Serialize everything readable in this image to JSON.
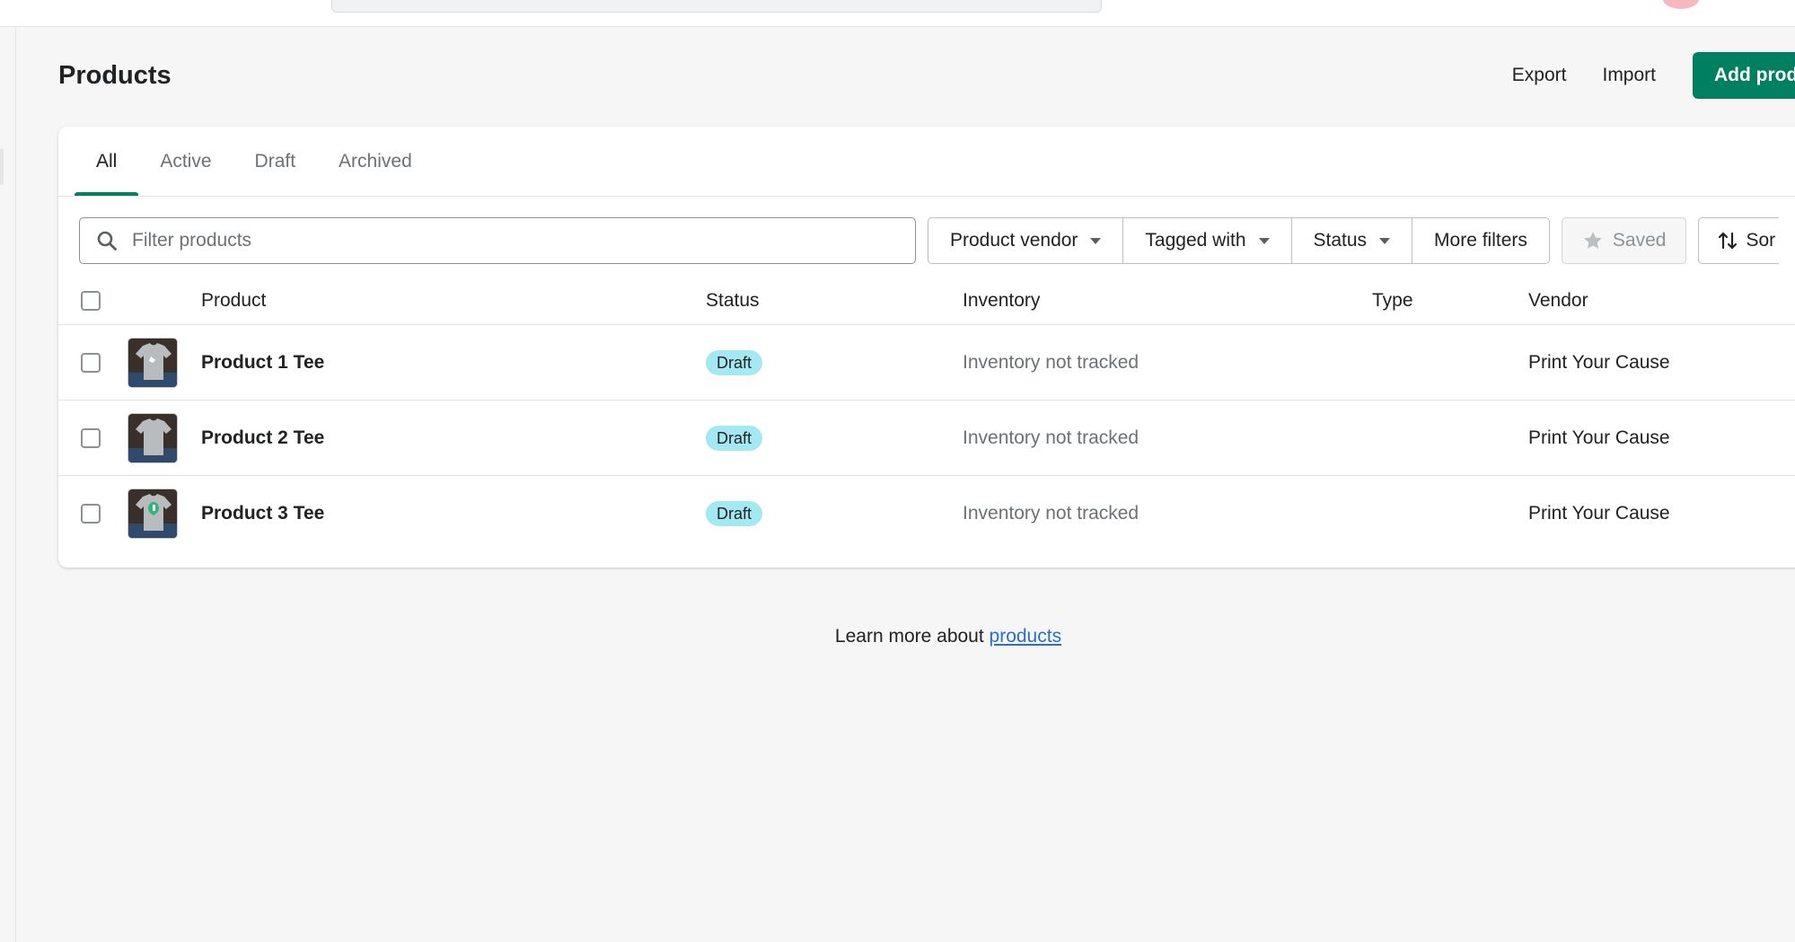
{
  "page": {
    "title": "Products"
  },
  "header": {
    "export_label": "Export",
    "import_label": "Import",
    "add_label": "Add prod"
  },
  "tabs": [
    {
      "label": "All",
      "active": true
    },
    {
      "label": "Active",
      "active": false
    },
    {
      "label": "Draft",
      "active": false
    },
    {
      "label": "Archived",
      "active": false
    }
  ],
  "filters": {
    "search_placeholder": "Filter products",
    "search_value": "",
    "buttons": [
      "Product vendor",
      "Tagged with",
      "Status",
      "More filters"
    ],
    "saved_label": "Saved",
    "sort_label": "Sor"
  },
  "table": {
    "headers": {
      "product": "Product",
      "status": "Status",
      "inventory": "Inventory",
      "type": "Type",
      "vendor": "Vendor"
    },
    "rows": [
      {
        "name": "Product 1 Tee",
        "status": "Draft",
        "inventory": "Inventory not tracked",
        "type": "",
        "vendor": "Print Your Cause"
      },
      {
        "name": "Product 2 Tee",
        "status": "Draft",
        "inventory": "Inventory not tracked",
        "type": "",
        "vendor": "Print Your Cause"
      },
      {
        "name": "Product 3 Tee",
        "status": "Draft",
        "inventory": "Inventory not tracked",
        "type": "",
        "vendor": "Print Your Cause"
      }
    ]
  },
  "footer": {
    "text": "Learn more about ",
    "link": "products"
  },
  "icons": {
    "search": "search-icon",
    "caret": "caret-down-icon",
    "star": "star-icon",
    "sort": "sort-arrows-icon"
  },
  "colors": {
    "primary": "#008060",
    "badge_draft": "#a4e8f2",
    "link": "#2c6ecb"
  }
}
